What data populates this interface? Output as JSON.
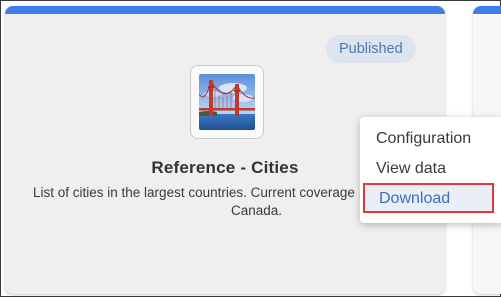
{
  "card": {
    "status_badge": "Published",
    "title": "Reference - Cities",
    "description_line1": "List of cities in the largest countries. Current coverage",
    "description_line2": "Canada."
  },
  "menu": {
    "items": [
      {
        "label": "Configuration"
      },
      {
        "label": "View data"
      },
      {
        "label": "Download",
        "highlighted": true
      }
    ]
  },
  "colors": {
    "accent_bar": "#3e7ee6",
    "badge_bg": "#dde4ee",
    "badge_text": "#4a78b5",
    "highlight_border": "#e0373d",
    "link_text": "#3c6fc0"
  },
  "icons": {
    "thumbnail": "golden-gate-bridge-image"
  }
}
